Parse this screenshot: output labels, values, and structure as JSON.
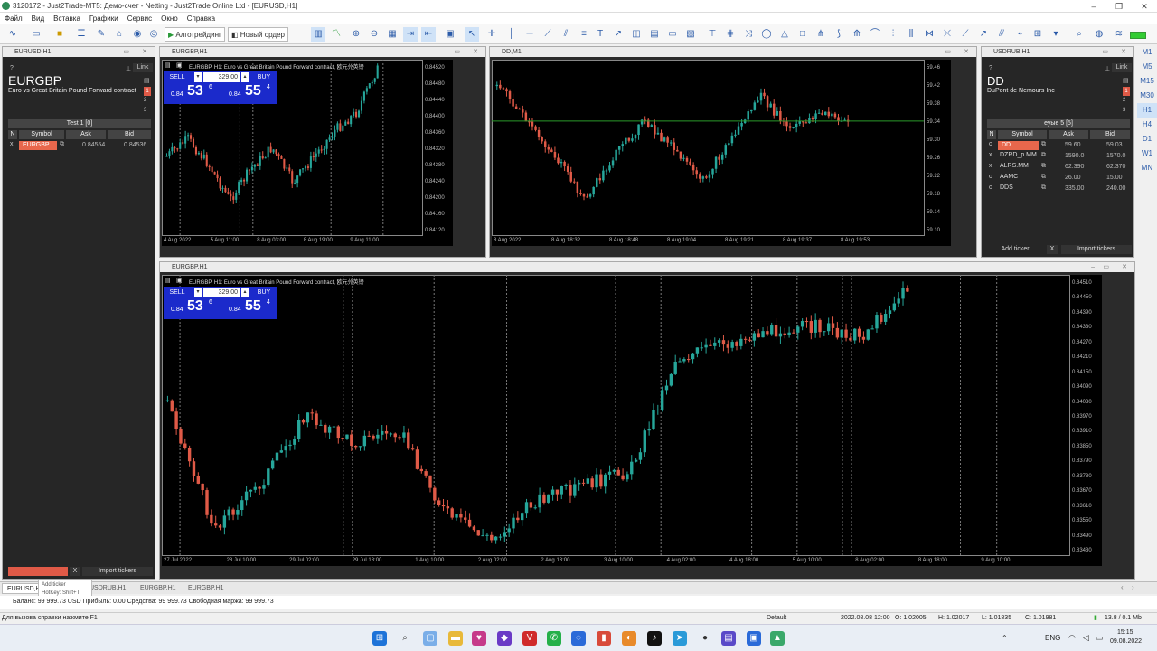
{
  "window": {
    "title": "3120172 - Just2Trade-MT5: Демо-счет - Netting - Just2Trade Online Ltd - [EURUSD,H1]"
  },
  "menu": [
    "Файл",
    "Вид",
    "Вставка",
    "Графики",
    "Сервис",
    "Окно",
    "Справка"
  ],
  "toolbar": {
    "algotrading_label": "Алготрейдинг",
    "new_order_label": "Новый ордер"
  },
  "timeframes": [
    "M1",
    "M5",
    "M15",
    "M30",
    "H1",
    "H4",
    "D1",
    "W1",
    "MN"
  ],
  "active_timeframe": "H1",
  "windows": {
    "eurusd": {
      "title": "EURUSD,H1"
    },
    "eurgbp_top": {
      "title": "EURGBP,H1"
    },
    "dd": {
      "title": "DD,M1"
    },
    "usdrub": {
      "title": "USDRUB,H1"
    },
    "eurgbp_main": {
      "title": "EURGBP,H1"
    }
  },
  "left_panel": {
    "symbol": "EURGBP",
    "description": "Euro vs Great Britain Pound Forward contract",
    "link_label": "Link",
    "question": "?",
    "numbers": [
      "1",
      "2",
      "3"
    ],
    "list_title": "Test 1 [0]",
    "headers": {
      "n": "N",
      "symbol": "Symbol",
      "ask": "Ask",
      "bid": "Bid"
    },
    "rows": [
      {
        "n": "x",
        "symbol": "EURGBP",
        "ask": "0.84554",
        "bid": "0.84536"
      }
    ],
    "add_ticker_label": "Add ticker",
    "x_label": "X",
    "import_label": "Import tickers",
    "tooltip_line1": "Add ticker",
    "tooltip_line2": "HotKey: Shift+T"
  },
  "right_panel": {
    "symbol": "DD",
    "description": "DuPont de Nemours Inc",
    "link_label": "Link",
    "question": "?",
    "numbers": [
      "1",
      "2",
      "3"
    ],
    "list_title": "еуые 5 [5]",
    "headers": {
      "n": "N",
      "symbol": "Symbol",
      "ask": "Ask",
      "bid": "Bid"
    },
    "rows": [
      {
        "n": "o",
        "symbol": "DD",
        "ask": "59.60",
        "bid": "59.03"
      },
      {
        "n": "x",
        "symbol": "DZRD_p.MM",
        "ask": "1590.0",
        "bid": "1570.0"
      },
      {
        "n": "x",
        "symbol": "ALRS.MM",
        "ask": "62.390",
        "bid": "62.370"
      },
      {
        "n": "o",
        "symbol": "AAMC",
        "ask": "26.00",
        "bid": "15.00"
      },
      {
        "n": "o",
        "symbol": "DDS",
        "ask": "335.00",
        "bid": "240.00"
      }
    ],
    "add_ticker_label": "Add ticker",
    "x_label": "X",
    "import_label": "Import tickers"
  },
  "trade_panel": {
    "sell": "SELL",
    "buy": "BUY",
    "volume": "329.00",
    "bid_prefix": "0.84",
    "bid_big": "53",
    "bid_small": "6",
    "ask_prefix": "0.84",
    "ask_big": "55",
    "ask_small": "4"
  },
  "chart_eurgbp_top": {
    "caption": "EURGBP, H1:  Euro vs Great Britain Pound Forward contract, 欧元兑英镑",
    "y_ticks": [
      "0.84520",
      "0.84480",
      "0.84440",
      "0.84400",
      "0.84360",
      "0.84320",
      "0.84280",
      "0.84240",
      "0.84200",
      "0.84160",
      "0.84120"
    ],
    "x_ticks": [
      "4 Aug 2022",
      "5 Aug 11:00",
      "8 Aug 03:00",
      "8 Aug 19:00",
      "9 Aug 11:00"
    ]
  },
  "chart_dd": {
    "y_ticks": [
      "59.46",
      "59.42",
      "59.38",
      "59.34",
      "59.30",
      "59.26",
      "59.22",
      "59.18",
      "59.14",
      "59.10"
    ],
    "x_ticks": [
      "8 Aug 2022",
      "8 Aug 18:32",
      "8 Aug 18:48",
      "8 Aug 19:04",
      "8 Aug 19:21",
      "8 Aug 19:37",
      "8 Aug 19:53"
    ]
  },
  "chart_eurgbp_main": {
    "caption": "EURGBP, H1:  Euro vs Great Britain Pound Forward contract, 欧元兑英镑",
    "y_ticks": [
      "0.84510",
      "0.84450",
      "0.84390",
      "0.84330",
      "0.84270",
      "0.84210",
      "0.84150",
      "0.84090",
      "0.84030",
      "0.83970",
      "0.83910",
      "0.83850",
      "0.83790",
      "0.83730",
      "0.83670",
      "0.83610",
      "0.83550",
      "0.83490",
      "0.83430"
    ],
    "x_ticks": [
      "27 Jul 2022",
      "28 Jul 10:00",
      "29 Jul 02:00",
      "29 Jul 18:00",
      "1 Aug 10:00",
      "2 Aug 02:00",
      "2 Aug 18:00",
      "3 Aug 10:00",
      "4 Aug 02:00",
      "4 Aug 18:00",
      "5 Aug 10:00",
      "8 Aug 02:00",
      "8 Aug 18:00",
      "9 Aug 10:00"
    ]
  },
  "bottom_tabs": [
    "EURUSD,H1",
    "USDRUB,H1",
    "EURGBP,H1",
    "EURGBP,H1"
  ],
  "balance_line": "Баланс: 99 999.73 USD  Прибыль: 0.00  Средства: 99 999.73  Свободная маржа: 99 999.73",
  "statusbar": {
    "help": "Для вызова справки нажмите F1",
    "profile": "Default",
    "datetime": "2022.08.08 12:00",
    "open": "O: 1.02005",
    "high": "H: 1.02017",
    "low": "L: 1.01835",
    "close": "C: 1.01981",
    "traffic": "13.8 / 0.1 Mb"
  },
  "taskbar": {
    "lang": "ENG",
    "time": "15:15",
    "date": "09.08.2022"
  },
  "colors": {
    "bull": "#26a69a",
    "bear": "#e05a47",
    "chart_bg": "#000000",
    "panel_bg": "#262626",
    "trade_blue": "#1b2acb"
  }
}
